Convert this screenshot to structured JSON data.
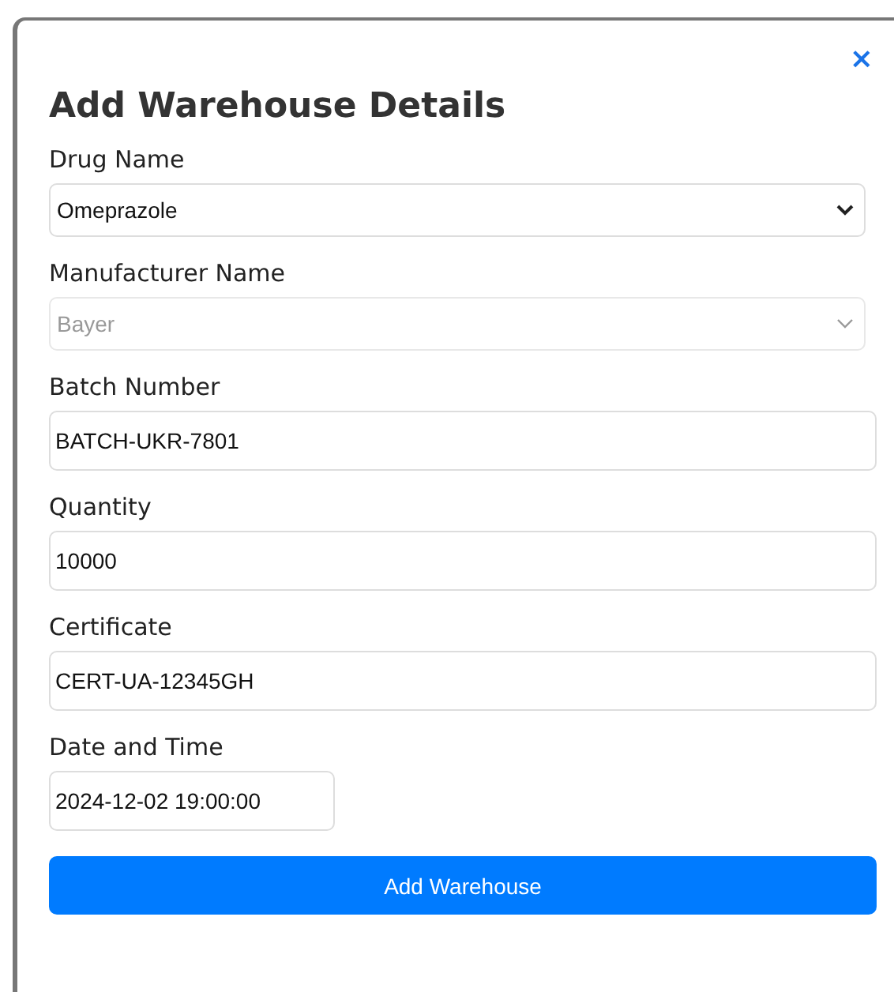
{
  "dialog": {
    "close": "×",
    "title": "Add Warehouse Details"
  },
  "fields": [
    {
      "label": "Drug Name",
      "kind": "select",
      "value": "Omeprazole",
      "disabled": false
    },
    {
      "label": "Manufacturer Name",
      "kind": "select",
      "value": "Bayer",
      "disabled": true
    },
    {
      "label": "Batch Number",
      "kind": "text",
      "value": "BATCH-UKR-7801"
    },
    {
      "label": "Quantity",
      "kind": "text",
      "value": "10000"
    },
    {
      "label": "Certificate",
      "kind": "text",
      "value": "CERT-UA-12345GH"
    },
    {
      "label": "Date and Time",
      "kind": "datetime",
      "value": "2024-12-02 19:00:00"
    }
  ],
  "submit": "Add Warehouse"
}
